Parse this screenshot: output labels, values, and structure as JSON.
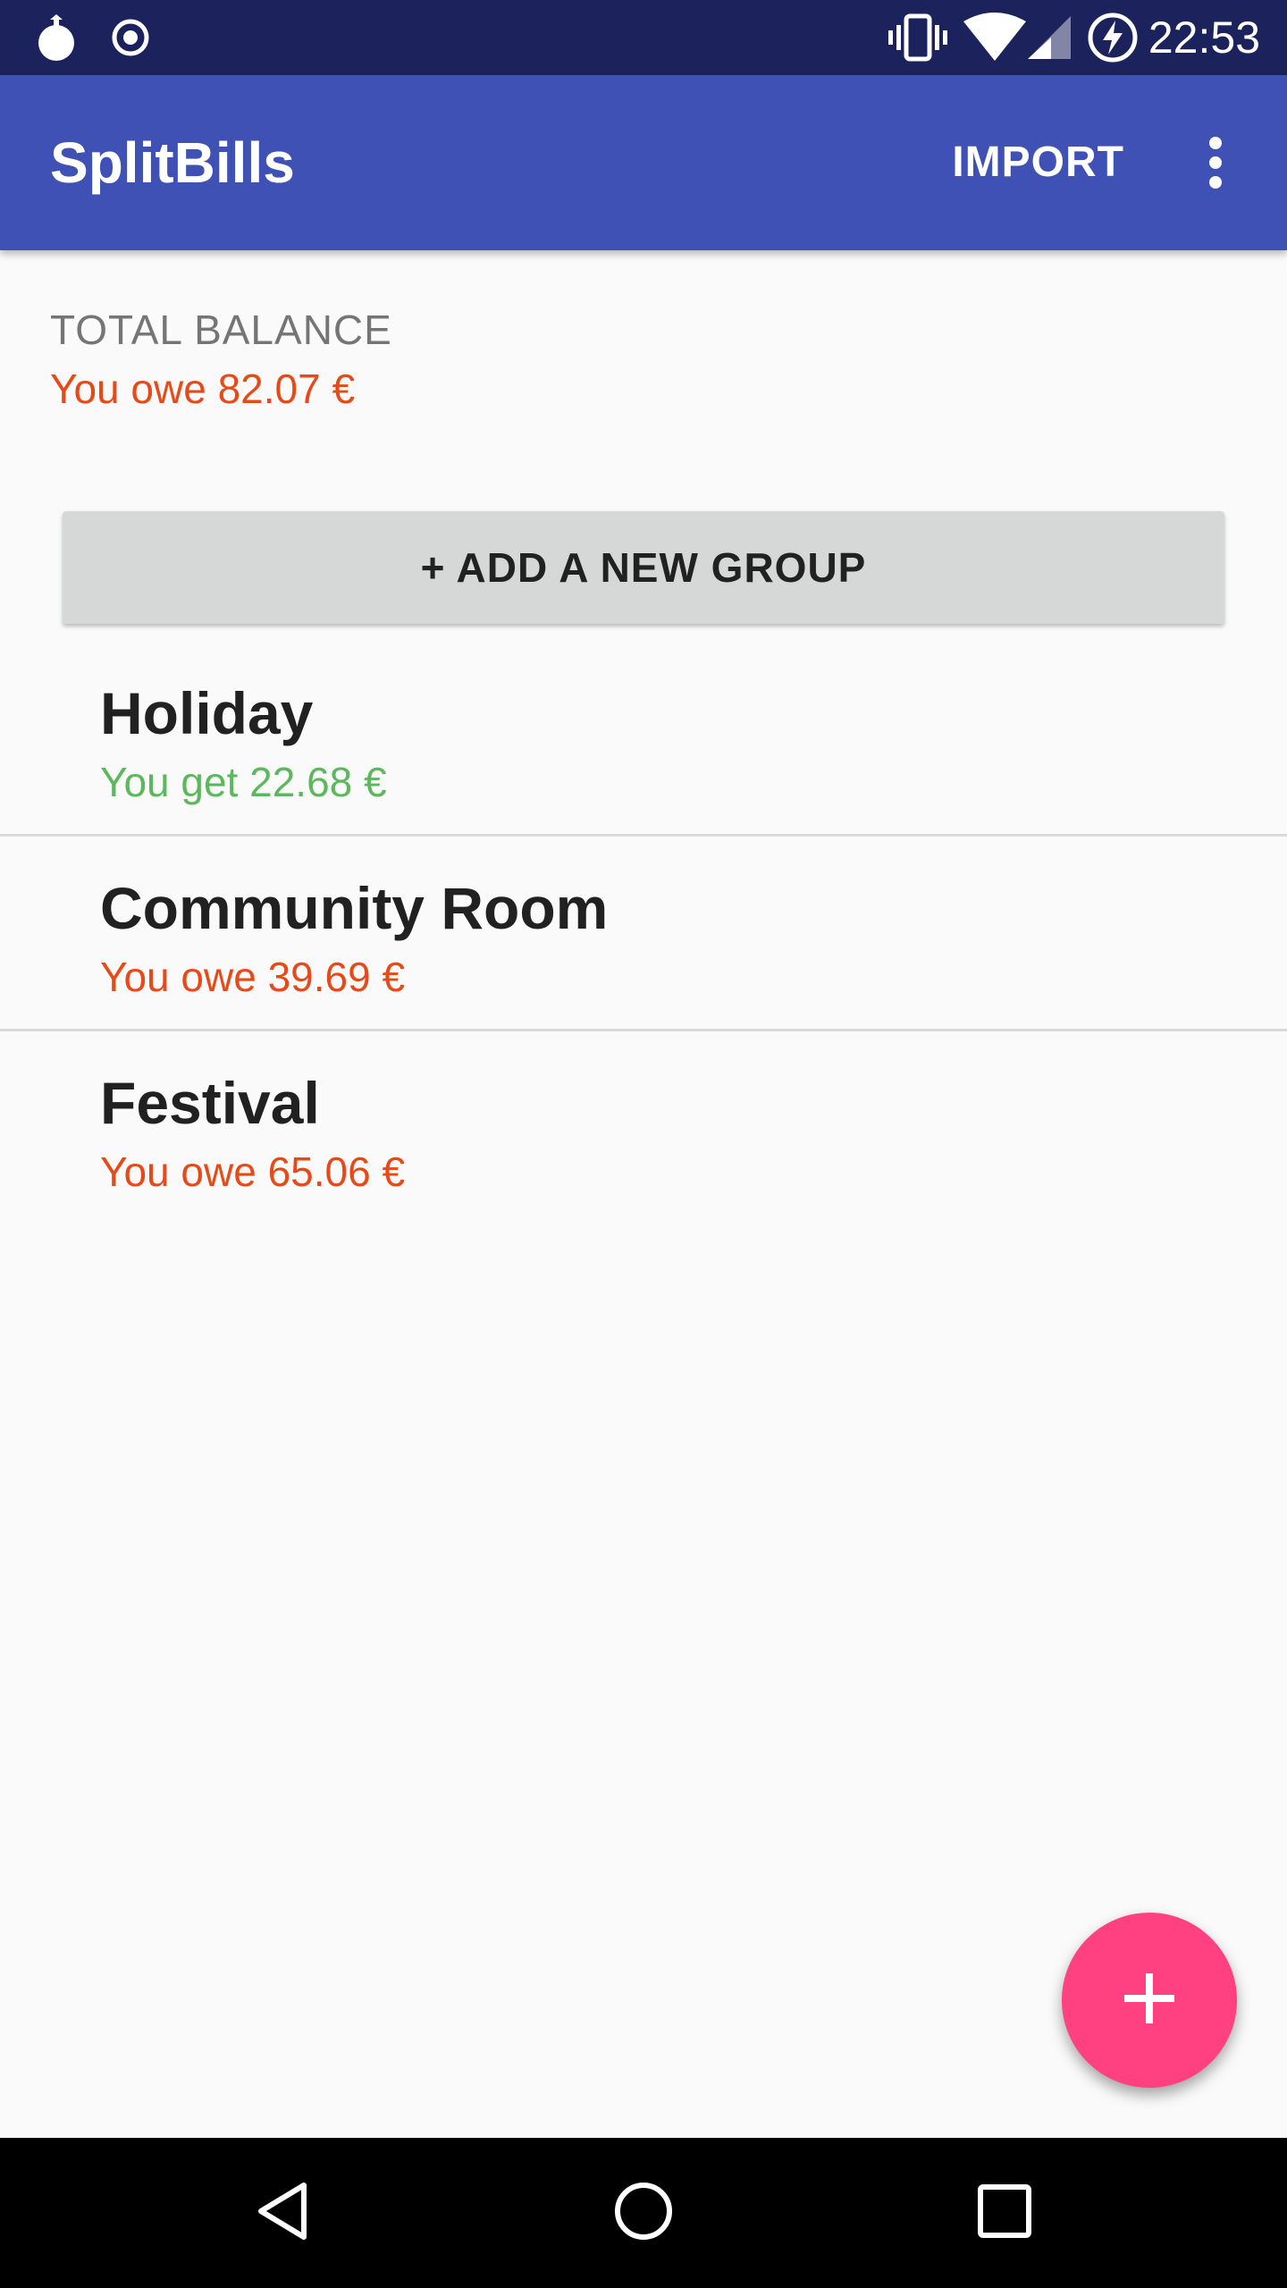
{
  "status_bar": {
    "time": "22:53",
    "icons": [
      "pomegranate-icon",
      "target-icon",
      "vibrate-icon",
      "wifi-icon",
      "signal-icon",
      "battery-charging-icon"
    ]
  },
  "app_bar": {
    "title": "SplitBills",
    "import_label": "IMPORT",
    "menu_icon": "more-vert-icon"
  },
  "summary": {
    "label": "TOTAL BALANCE",
    "value": "You owe 82.07 €"
  },
  "add_group_label": "+ ADD A NEW GROUP",
  "groups": [
    {
      "name": "Holiday",
      "balance": "You get 22.68 €",
      "status": "positive"
    },
    {
      "name": "Community Room",
      "balance": "You owe 39.69 €",
      "status": "negative"
    },
    {
      "name": "Festival",
      "balance": "You owe 65.06 €",
      "status": "negative"
    }
  ],
  "fab_icon": "plus-icon",
  "nav_icons": [
    "back-icon",
    "home-icon",
    "recents-icon"
  ],
  "colors": {
    "primary": "#3F51B5",
    "primary_dark": "#1C225C",
    "accent": "#FF4081",
    "owe": "#E64A19",
    "get": "#5CB85C"
  }
}
